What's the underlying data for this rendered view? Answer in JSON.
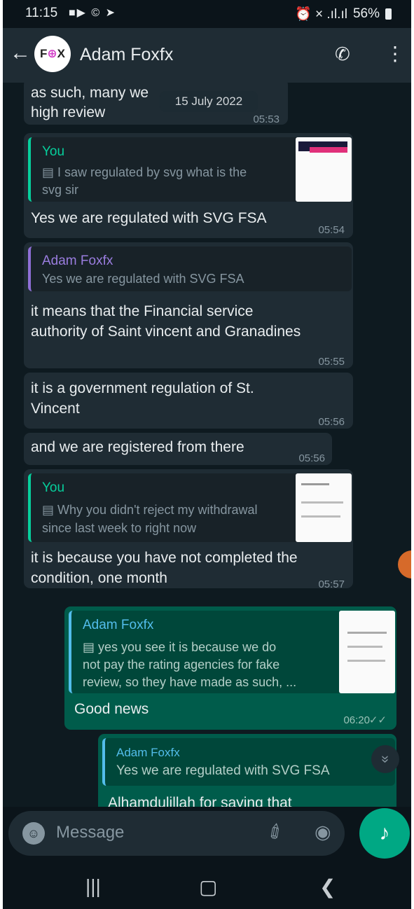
{
  "status_bar": {
    "time": "11:15",
    "left_icons": "■▶ © ➤",
    "right_icons": "⏰ × .ıl.ıl",
    "battery": "56%"
  },
  "header": {
    "back": "←",
    "avatar_text_a": "F",
    "avatar_text_o": "⊕",
    "avatar_text_b": "X",
    "contact_name": "Adam Foxfx",
    "call_icon": "✆",
    "menu_icon": "⋮"
  },
  "chat": {
    "date_pill": "15 July 2022",
    "messages": [
      {
        "id": "m1",
        "lines": [
          "as such, many we",
          "high review"
        ],
        "time": "05:53"
      },
      {
        "id": "m2",
        "quote_author": "You",
        "quote_lines": [
          "▤ I saw regulated by svg  what is the",
          "svg sir"
        ],
        "text": "Yes we are regulated with SVG FSA",
        "time": "05:54"
      },
      {
        "id": "m3",
        "quote_author": "Adam Foxfx",
        "quote_lines": [
          "Yes we are regulated with SVG FSA"
        ],
        "lines": [
          "it means that the Financial service",
          "authority of Saint vincent and Granadines"
        ],
        "time": "05:55"
      },
      {
        "id": "m4",
        "lines": [
          "it is a government regulation of St.",
          "Vincent"
        ],
        "time": "05:56"
      },
      {
        "id": "m5",
        "text": "and we are registered from there",
        "time": "05:56"
      },
      {
        "id": "m6",
        "quote_author": "You",
        "quote_lines": [
          "▤ Why you didn't reject my withdrawal",
          "since last week to right now"
        ],
        "lines": [
          "it is because you have not completed the",
          "condition, one month"
        ],
        "time": "05:57"
      },
      {
        "id": "m7",
        "quote_author": "Adam Foxfx",
        "quote_lines": [
          "▤ yes you see it is because we do",
          "not pay the rating agencies for fake",
          "review, so they have made as such, ..."
        ],
        "text": "Good news",
        "time": "06:20",
        "ticks": "✓✓"
      },
      {
        "id": "m8",
        "quote_author": "Adam Foxfx",
        "quote_lines": [
          "Yes we are regulated with SVG FSA"
        ],
        "text": "Alhamdulillah for saying that"
      }
    ]
  },
  "scroll_down_icon": "»",
  "input": {
    "placeholder": "Message",
    "emoji_icon": "☺",
    "attach_icon": "✐",
    "camera_icon": "◉",
    "mic_icon": "♪"
  },
  "navbar": {
    "recents": "|||",
    "home": "▢",
    "back": "❮"
  }
}
